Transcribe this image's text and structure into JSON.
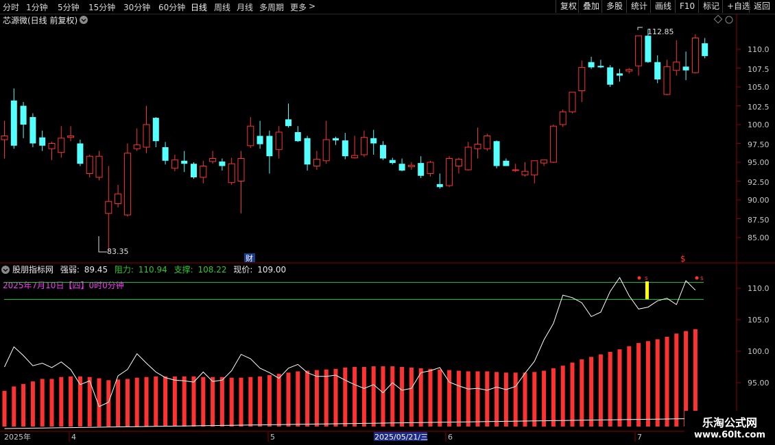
{
  "toolbar": {
    "periods": [
      "分时",
      "1分钟",
      "5分钟",
      "15分钟",
      "30分钟",
      "60分钟",
      "日线",
      "周线",
      "月线",
      "多周期",
      "更多"
    ],
    "active_period": "日线",
    "more_arrow": ">",
    "right_buttons": [
      "复权",
      "叠加",
      "多股",
      "统计",
      "画线",
      "F10",
      "标记",
      "+自选",
      "返回"
    ]
  },
  "colors": {
    "up": "#ff3232",
    "down": "#54ffff",
    "grid": "#8b0000",
    "line": "#ffffff",
    "green": "#2ec82e",
    "magenta": "#ff33ff",
    "yellow": "#ffff00"
  },
  "main_panel": {
    "title": "芯源微(日线 前复权)",
    "high_label": "112.85",
    "low_label": "83.35",
    "cai_badge": "财",
    "dollar_badge": "$",
    "y_ticks": [
      "110.0",
      "107.5",
      "105.0",
      "102.5",
      "100.0",
      "97.50",
      "95.00",
      "92.50",
      "90.00",
      "87.50",
      "85.00"
    ]
  },
  "indicator_panel": {
    "name": "股朋指标网",
    "strength_label": "强弱:",
    "strength_value": "89.45",
    "resistance_label": "阻力:",
    "resistance_value": "110.94",
    "support_label": "支撑:",
    "support_value": "108.22",
    "price_label": "现价:",
    "price_value": "109.00",
    "date_info": "2025年7月10日【四】0时0分钟",
    "y_ticks": [
      "110.0",
      "105.0",
      "100.0",
      "95.00"
    ],
    "signal_small": "s"
  },
  "x_axis": {
    "labels": [
      "2025年",
      "4",
      "5",
      "2025/05/21/三",
      "6",
      "7"
    ]
  },
  "watermark": {
    "line1": "乐淘公式网",
    "line2": "www.60lt.com"
  },
  "chart_data": {
    "type": "candlestick",
    "title": "芯源微(日线 前复权)",
    "ylim": [
      82.5,
      113.5
    ],
    "ohlc": [
      [
        98.0,
        100.5,
        95.5,
        98.5
      ],
      [
        103.2,
        104.8,
        96.8,
        97.2
      ],
      [
        102.5,
        103.0,
        98.2,
        100.0
      ],
      [
        101.0,
        101.5,
        97.0,
        97.5
      ],
      [
        98.3,
        99.2,
        96.5,
        97.2
      ],
      [
        96.8,
        97.7,
        95.3,
        97.5
      ],
      [
        96.3,
        99.8,
        95.6,
        98.2
      ],
      [
        98.3,
        99.8,
        97.8,
        98.5
      ],
      [
        97.5,
        98.0,
        94.5,
        94.8
      ],
      [
        93.5,
        96.0,
        93.0,
        95.8
      ],
      [
        93.0,
        96.5,
        92.6,
        95.8
      ],
      [
        88.2,
        94.5,
        83.3,
        89.8
      ],
      [
        89.5,
        92.0,
        89.0,
        90.8
      ],
      [
        88.0,
        97.5,
        87.8,
        96.2
      ],
      [
        96.8,
        99.5,
        96.5,
        97.3
      ],
      [
        97.0,
        102.5,
        96.2,
        100.0
      ],
      [
        100.9,
        101.0,
        97.0,
        97.8
      ],
      [
        97.0,
        97.7,
        94.7,
        95.2
      ],
      [
        94.2,
        96.0,
        93.8,
        95.3
      ],
      [
        95.2,
        96.5,
        93.7,
        94.8
      ],
      [
        94.8,
        95.0,
        92.8,
        93.0
      ],
      [
        93.0,
        95.2,
        92.2,
        94.5
      ],
      [
        95.1,
        96.5,
        94.8,
        95.5
      ],
      [
        95.1,
        95.5,
        93.9,
        94.5
      ],
      [
        92.3,
        95.6,
        92.0,
        94.8
      ],
      [
        92.5,
        96.5,
        88.2,
        95.5
      ],
      [
        97.2,
        101.0,
        96.9,
        99.8
      ],
      [
        98.5,
        100.5,
        96.8,
        97.4
      ],
      [
        98.5,
        99.2,
        93.5,
        95.8
      ],
      [
        96.7,
        99.8,
        95.5,
        99.0
      ],
      [
        100.7,
        102.8,
        99.6,
        99.8
      ],
      [
        99.0,
        99.8,
        97.7,
        97.8
      ],
      [
        98.2,
        98.5,
        93.9,
        94.7
      ],
      [
        94.5,
        96.5,
        94.0,
        95.4
      ],
      [
        95.2,
        100.5,
        94.8,
        98.0
      ],
      [
        98.2,
        98.4,
        97.3,
        97.9
      ],
      [
        97.9,
        98.9,
        95.4,
        95.8
      ],
      [
        95.6,
        98.5,
        95.5,
        95.9
      ],
      [
        96.0,
        99.2,
        95.7,
        98.3
      ],
      [
        98.2,
        99.3,
        96.0,
        97.5
      ],
      [
        97.3,
        97.8,
        95.3,
        95.5
      ],
      [
        95.3,
        95.6,
        94.7,
        94.9
      ],
      [
        94.8,
        95.5,
        93.8,
        93.9
      ],
      [
        94.4,
        95.0,
        94.0,
        94.6
      ],
      [
        94.9,
        95.8,
        92.9,
        93.2
      ],
      [
        93.5,
        95.2,
        93.1,
        95.0
      ],
      [
        92.1,
        93.5,
        91.5,
        91.7
      ],
      [
        91.9,
        95.8,
        91.7,
        95.5
      ],
      [
        94.5,
        95.6,
        93.5,
        95.4
      ],
      [
        94.0,
        97.7,
        93.9,
        97.0
      ],
      [
        96.8,
        99.6,
        95.5,
        97.4
      ],
      [
        96.8,
        98.8,
        96.5,
        98.5
      ],
      [
        97.8,
        97.9,
        94.2,
        94.5
      ],
      [
        95.2,
        95.5,
        94.5,
        94.5
      ],
      [
        93.9,
        94.8,
        93.7,
        94.0
      ],
      [
        93.3,
        95.0,
        93.1,
        93.8
      ],
      [
        93.3,
        95.2,
        92.2,
        95.2
      ],
      [
        94.9,
        95.3,
        94.5,
        95.3
      ],
      [
        95.0,
        100.0,
        94.9,
        99.8
      ],
      [
        100.0,
        102.0,
        99.7,
        101.7
      ],
      [
        101.7,
        104.2,
        101.5,
        104.3
      ],
      [
        104.5,
        108.5,
        103.0,
        107.6
      ],
      [
        108.3,
        109.0,
        107.4,
        107.6
      ],
      [
        107.8,
        108.6,
        107.5,
        107.6
      ],
      [
        107.6,
        107.9,
        105.0,
        105.3
      ],
      [
        106.8,
        107.4,
        105.7,
        106.5
      ],
      [
        107.1,
        107.5,
        106.8,
        107.3
      ],
      [
        107.8,
        109.0,
        106.5,
        111.8
      ],
      [
        111.8,
        112.7,
        108.2,
        108.3
      ],
      [
        108.3,
        109.2,
        105.5,
        106.0
      ],
      [
        104.0,
        108.6,
        103.9,
        107.7
      ],
      [
        107.2,
        111.2,
        106.5,
        108.3
      ],
      [
        107.7,
        109.7,
        105.9,
        107.2
      ],
      [
        106.9,
        112.0,
        106.8,
        111.5
      ],
      [
        110.8,
        111.5,
        108.8,
        109.1
      ]
    ],
    "indicator": {
      "resistance": 110.94,
      "support": 108.22,
      "ylim": [
        91.0,
        112.5
      ],
      "line": [
        97.5,
        100.7,
        99.3,
        97.7,
        98.1,
        97.4,
        98.3,
        97.1,
        94.7,
        95.3,
        91.2,
        91.9,
        96.1,
        97.1,
        99.6,
        98.1,
        96.7,
        95.8,
        95.4,
        95.3,
        95.1,
        96.7,
        95.2,
        95.4,
        96.9,
        99.5,
        98.8,
        97.3,
        96.6,
        95.7,
        97.3,
        97.9,
        96.6,
        96.0,
        96.0,
        96.2,
        95.4,
        94.7,
        94.1,
        94.7,
        93.4,
        95.0,
        93.8,
        94.1,
        96.6,
        96.9,
        97.4,
        95.1,
        94.5,
        94.0,
        94.1,
        93.8,
        94.3,
        93.9,
        94.4,
        96.5,
        98.4,
        101.8,
        104.4,
        108.9,
        108.5,
        107.7,
        105.5,
        106.2,
        109.5,
        111.7,
        108.8,
        106.7,
        107.0,
        108.0,
        108.4,
        107.4,
        111.2,
        109.7
      ],
      "bars": [
        93.7,
        94.4,
        94.8,
        95.2,
        95.6,
        95.6,
        95.9,
        96.0,
        96.0,
        95.9,
        95.7,
        95.4,
        95.5,
        95.6,
        95.8,
        95.9,
        96.0,
        96.0,
        96.0,
        96.0,
        96.0,
        95.9,
        95.9,
        95.9,
        95.8,
        95.8,
        95.9,
        96.0,
        96.2,
        96.4,
        96.6,
        96.8,
        96.9,
        97.0,
        97.1,
        97.2,
        97.4,
        97.5,
        97.5,
        97.6,
        97.6,
        97.6,
        97.5,
        97.4,
        97.3,
        97.2,
        97.1,
        97.0,
        96.9,
        96.8,
        96.8,
        96.8,
        96.7,
        96.6,
        96.6,
        96.6,
        96.7,
        96.9,
        97.3,
        97.7,
        98.2,
        98.7,
        99.1,
        99.5,
        99.9,
        100.3,
        100.8,
        101.3,
        101.6,
        101.9,
        102.3,
        102.8,
        103.2,
        103.5
      ]
    }
  }
}
